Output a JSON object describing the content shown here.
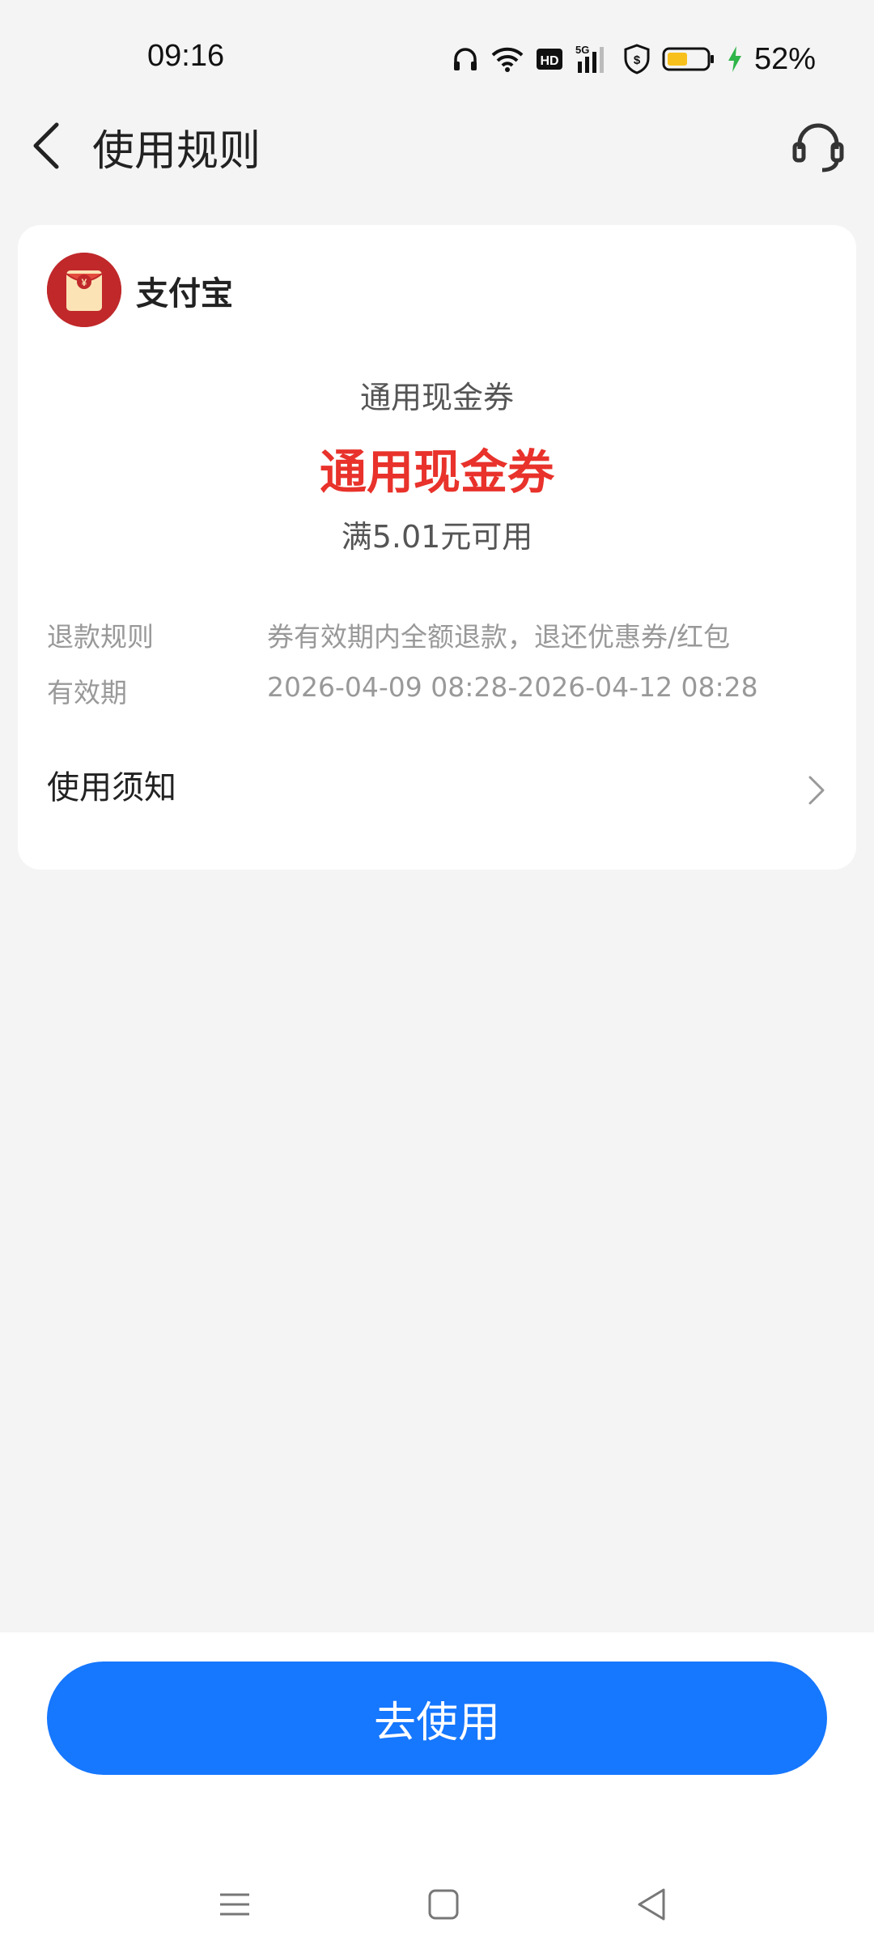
{
  "status_bar": {
    "time": "09:16",
    "battery_percent": "52%",
    "battery_level": 0.52,
    "icons": [
      "headphones-icon",
      "wifi-icon",
      "hd-icon",
      "5g-signal-icon",
      "shield-icon",
      "battery-icon",
      "charging-icon"
    ]
  },
  "header": {
    "title": "使用规则",
    "back_icon": "chevron-left-icon",
    "support_icon": "headset-icon"
  },
  "card": {
    "merchant_name": "支付宝",
    "merchant_logo_icon": "red-envelope-yuan-icon",
    "coupon_type": "通用现金券",
    "coupon_title": "通用现金券",
    "condition": "满5.01元可用",
    "rules": [
      {
        "label": "退款规则",
        "value": "券有效期内全额退款，退还优惠券/红包"
      },
      {
        "label": "有效期",
        "value": "2026-04-09 08:28-2026-04-12 08:28"
      }
    ],
    "notice_label": "使用须知"
  },
  "action": {
    "use_button_label": "去使用"
  },
  "nav_bar": {
    "buttons": [
      "menu-icon",
      "home-icon",
      "back-triangle-icon"
    ]
  },
  "colors": {
    "accent_blue": "#1677ff",
    "coupon_red": "#e8322b",
    "background": "#f4f4f4"
  }
}
